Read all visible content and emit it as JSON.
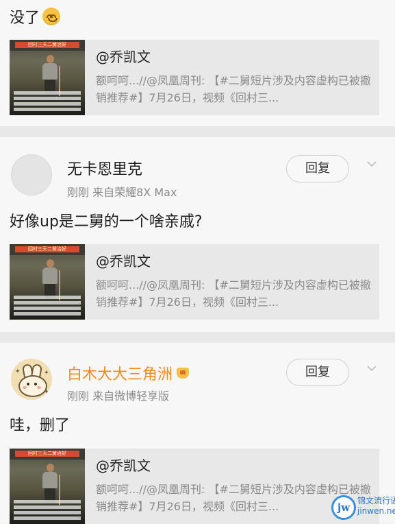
{
  "top_item": {
    "text": "没了"
  },
  "shared_card_title": "@乔凯文",
  "shared_card_desc": "额呵呵...//@凤凰周刊: 【#二舅短片涉及内容虚构已被撤销推荐#】7月26日，视频《回村三...",
  "thumb_title": "回村三天二舅治好",
  "comments": [
    {
      "username": "无卡恩里克",
      "time": "刚刚",
      "source": "来自荣耀8X Max",
      "text": "好像up是二舅的一个啥亲戚?",
      "reply_label": "回复"
    },
    {
      "username": "白木大大三角洲",
      "time": "刚刚",
      "source": "来自微博轻享版",
      "text": "哇，删了",
      "reply_label": "回复",
      "username_color": "#f08a1a"
    }
  ],
  "watermark": {
    "badge": "jw",
    "line1": "锦文流行语",
    "line2": "jinwen.net"
  },
  "colors": {
    "background": "#f1f1f1",
    "card": "#e8e8e8",
    "secondary_text": "#8a8a8a",
    "highlight_username": "#f08a1a"
  }
}
